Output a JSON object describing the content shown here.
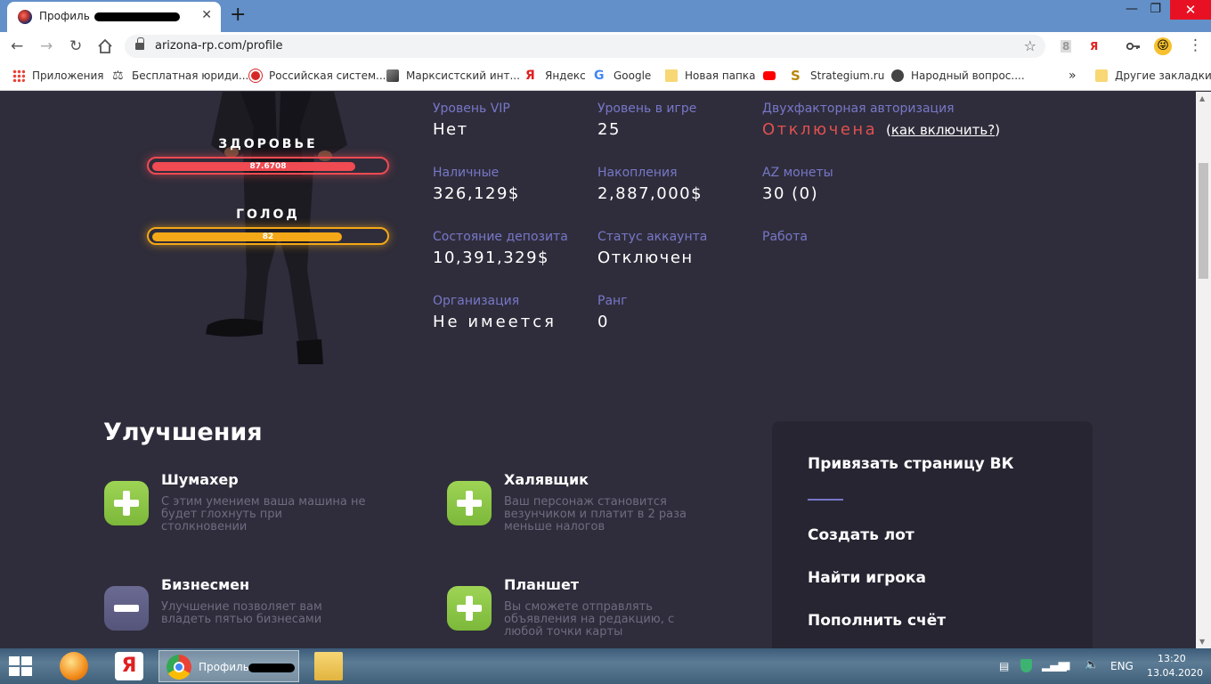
{
  "browser": {
    "tab_title": "Профиль",
    "tab_close": "✕",
    "new_tab": "+",
    "url": "arizona-rp.com/profile",
    "window_controls": {
      "minimize": "—",
      "restore": "❐",
      "close": "✕"
    },
    "ext_icon_1": "8",
    "ext_icon_2": "Я"
  },
  "bookmarks": [
    {
      "label": "Приложения",
      "icon": "apps-grid-icon"
    },
    {
      "label": "Бесплатная юриди...",
      "icon": "scales-icon"
    },
    {
      "label": "Российская систем...",
      "icon": "shield-icon"
    },
    {
      "label": "Марксистский инт...",
      "icon": "portrait-icon"
    },
    {
      "label": "Яндекс",
      "icon": "yandex-icon"
    },
    {
      "label": "Google",
      "icon": "google-icon"
    },
    {
      "label": "Новая папка",
      "icon": "folder-icon"
    },
    {
      "label": "",
      "icon": "youtube-icon"
    },
    {
      "label": "Strategium.ru",
      "icon": "strategium-icon"
    },
    {
      "label": "Народный вопрос....",
      "icon": "globe-icon"
    }
  ],
  "bookmarks_more": "»",
  "bookmarks_other": "Другие закладки",
  "bars": {
    "health": {
      "label": "ЗДОРОВЬЕ",
      "value_text": "87.6708",
      "fraction": 0.876708,
      "color": "#f04a52"
    },
    "hunger": {
      "label": "ГОЛОД",
      "value_text": "82",
      "fraction": 0.82,
      "color": "#f5a817"
    }
  },
  "profile": {
    "vip_label": "Уровень VIP",
    "vip_value": "Нет",
    "level_label": "Уровень в игре",
    "level_value": "25",
    "twofa_label": "Двухфакторная авторизация",
    "twofa_value": "Отключена",
    "twofa_link": "как включить?",
    "cash_label": "Наличные",
    "cash_value": "326,129$",
    "savings_label": "Накопления",
    "savings_value": "2,887,000$",
    "az_label": "AZ монеты",
    "az_value": "30 (0)",
    "deposit_label": "Состояние депозита",
    "deposit_value": "10,391,329$",
    "status_label": "Статус аккаунта",
    "status_value": "Отключен",
    "job_label": "Работа",
    "org_label": "Организация",
    "org_value": "Не имеется",
    "rank_label": "Ранг",
    "rank_value": "0"
  },
  "upgrades": {
    "title": "Улучшения",
    "items": [
      {
        "name": "Шумахер",
        "desc": "С этим умением ваша машина не будет глохнуть при столкновении",
        "state": "plus"
      },
      {
        "name": "Халявщик",
        "desc": "Ваш персонаж становится везунчиком и платит в 2 раза меньше налогов",
        "state": "plus"
      },
      {
        "name": "Бизнесмен",
        "desc": "Улучшение позволяет вам владеть пятью бизнесами",
        "state": "minus"
      },
      {
        "name": "Планшет",
        "desc": "Вы сможете отправлять объявления на редакцию, с любой точки карты",
        "state": "plus"
      }
    ]
  },
  "side_panel": {
    "vk": "Привязать страницу ВК",
    "lot": "Создать лот",
    "find": "Найти игрока",
    "topup": "Пополнить счёт"
  },
  "taskbar": {
    "task_label": "Профиль",
    "lang": "ENG",
    "time": "13:20",
    "date": "13.04.2020"
  }
}
